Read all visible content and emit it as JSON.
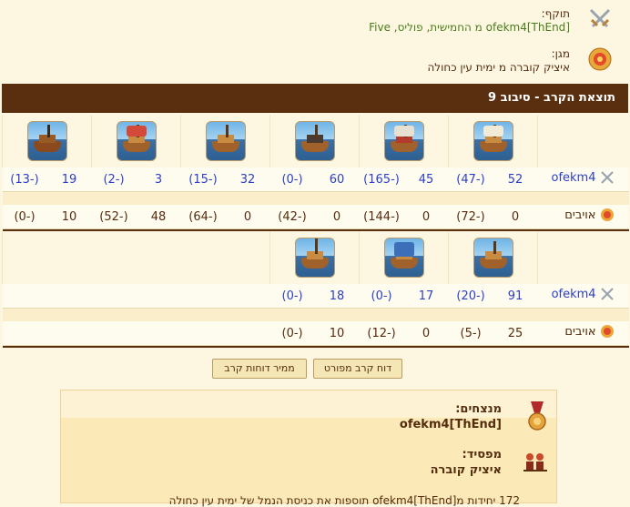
{
  "attacker": {
    "label": "תוקף:",
    "value": "[ofekm4[ThEnd מ החמישית, פוליס, Five",
    "icon": "crossed-swords-icon"
  },
  "defender": {
    "label": "מגן:",
    "value": "איציק קוברה מ ימית עין כחולה",
    "icon": "shield-icon"
  },
  "header": {
    "title": "תוצאת הקרב - סיבוב 9"
  },
  "round1": {
    "attacker_name": "ofekm4",
    "defender_name": "אויבים",
    "units": [
      {
        "icon": "catapult-ship-icon",
        "attacker": "52",
        "attacker_loss": "(-47)",
        "defender": "0",
        "defender_loss": "(-72)"
      },
      {
        "icon": "fire-ship-icon",
        "attacker": "45",
        "attacker_loss": "(-165)",
        "defender": "0",
        "defender_loss": "(-144)"
      },
      {
        "icon": "mortar-ship-icon",
        "attacker": "60",
        "attacker_loss": "(-0)",
        "defender": "0",
        "defender_loss": "(-42)"
      },
      {
        "icon": "ram-ship-icon",
        "attacker": "32",
        "attacker_loss": "(-15)",
        "defender": "0",
        "defender_loss": "(-64)"
      },
      {
        "icon": "ballista-ship-icon",
        "attacker": "3",
        "attacker_loss": "(-2)",
        "defender": "48",
        "defender_loss": "(-52)"
      },
      {
        "icon": "paddle-steamer-icon",
        "attacker": "19",
        "attacker_loss": "(-13)",
        "defender": "10",
        "defender_loss": "(-0)"
      }
    ]
  },
  "round2": {
    "attacker_name": "ofekm4",
    "defender_name": "אויבים",
    "units": [
      {
        "icon": "rocket-ship-icon",
        "attacker": "91",
        "attacker_loss": "(-20)",
        "defender": "25",
        "defender_loss": "(-5)"
      },
      {
        "icon": "balloon-carrier-icon",
        "attacker": "17",
        "attacker_loss": "(-0)",
        "defender": "0",
        "defender_loss": "(-12)"
      },
      {
        "icon": "crane-ship-icon",
        "attacker": "18",
        "attacker_loss": "(-0)",
        "defender": "10",
        "defender_loss": "(-0)"
      }
    ]
  },
  "buttons": {
    "detailed": "דוח קרב מפורט",
    "archive": "ממיר דוחות קרב"
  },
  "result": {
    "winners_label": "מנצחים:",
    "winners": "[ofekm4[ThEnd",
    "loser_label": "מפסיד:",
    "loser": "איציק קוברה",
    "footer": "172 יחידות מ[ofekm4[ThEnd תוספות את כניסת הנמל של ימית עין כחולה"
  },
  "colors": {
    "header_bg": "#5a2f10",
    "accent_blue": "#2c3fc9",
    "text_brown": "#542c0f",
    "green": "#4a7d1c"
  }
}
